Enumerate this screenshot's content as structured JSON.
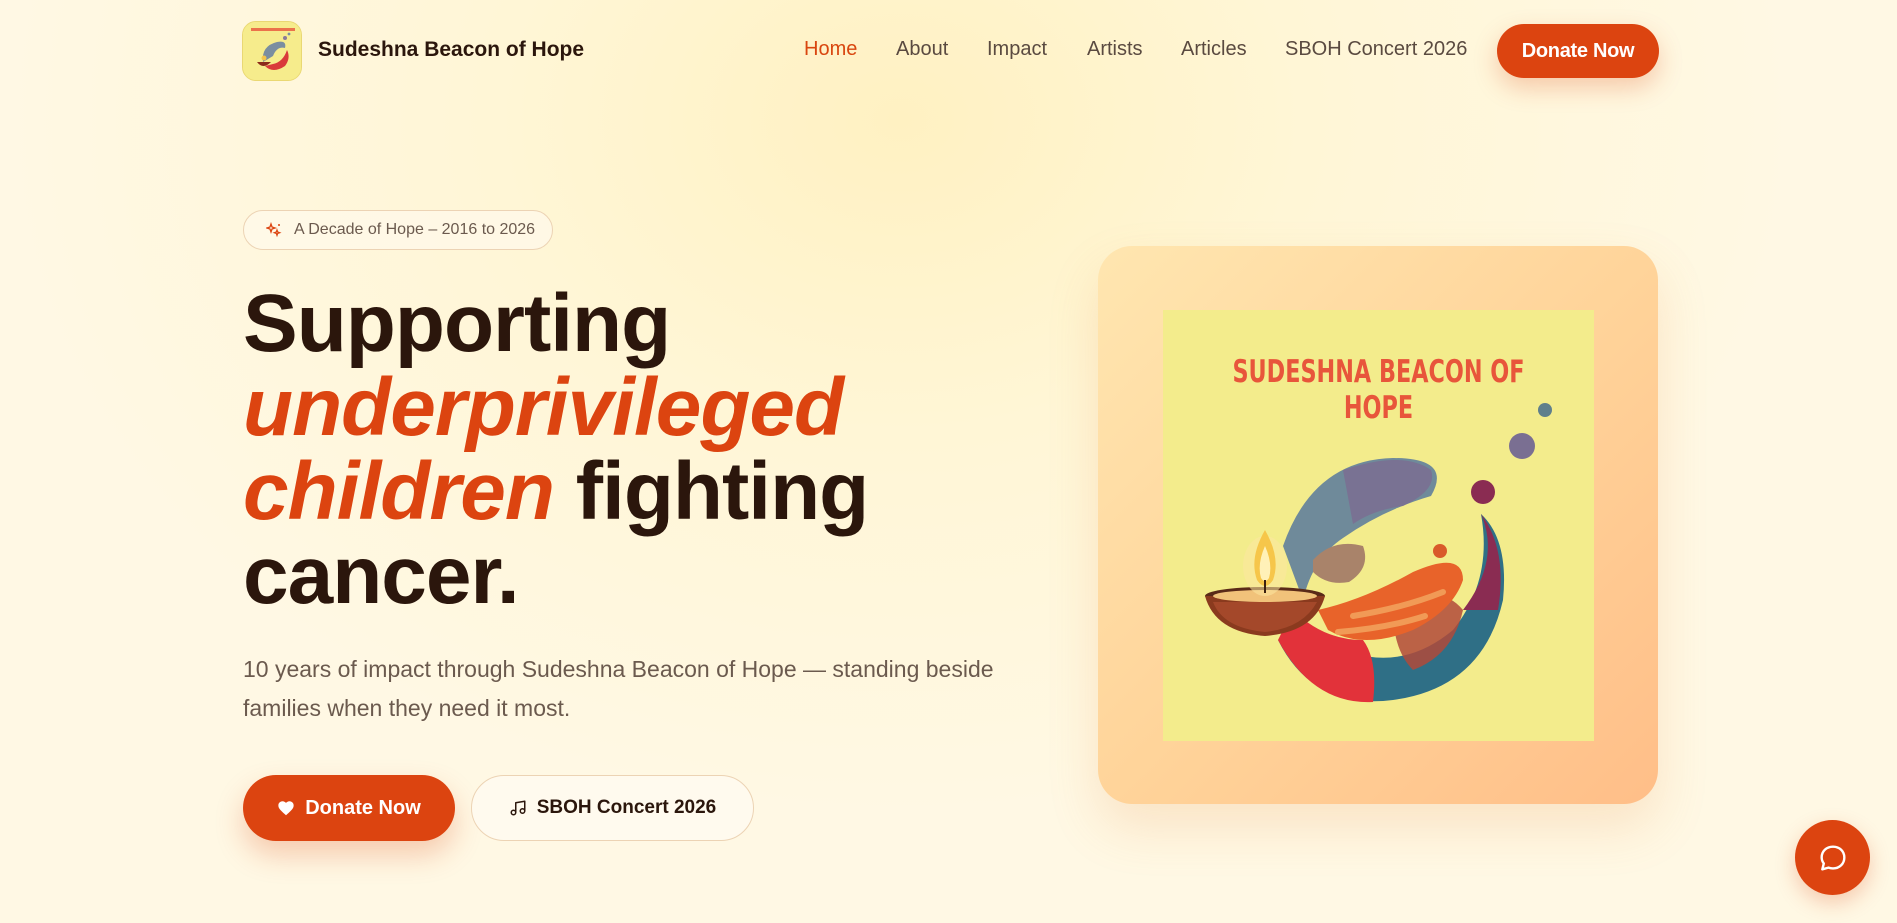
{
  "header": {
    "brand": "Sudeshna Beacon of Hope",
    "nav": [
      {
        "label": "Home",
        "active": true
      },
      {
        "label": "About",
        "active": false
      },
      {
        "label": "Impact",
        "active": false
      },
      {
        "label": "Artists",
        "active": false
      },
      {
        "label": "Articles",
        "active": false
      },
      {
        "label": "SBOH Concert 2026",
        "active": false
      }
    ],
    "donate_label": "Donate Now"
  },
  "hero": {
    "pill_text": "A Decade of Hope – 2016 to 2026",
    "headline": {
      "line1": "Supporting",
      "accent_line2": "underprivileged",
      "accent_line3": "children",
      "rest_line3": " fighting",
      "line4": "cancer."
    },
    "subtitle": "10 years of impact through Sudeshna Beacon of Hope — standing beside families when they need it most.",
    "donate_label": "Donate Now",
    "concert_label": "SBOH Concert 2026"
  },
  "artwork": {
    "title": "SUDESHNA BEACON OF HOPE"
  },
  "colors": {
    "accent": "#dc4410",
    "text": "#2b160c",
    "muted": "#6b5a4e",
    "art_background": "#f3ec8c"
  },
  "icons": {
    "pill": "sparkle-icon",
    "donate": "heart-icon",
    "concert": "music-note-icon",
    "chat": "chat-bubble-icon"
  }
}
